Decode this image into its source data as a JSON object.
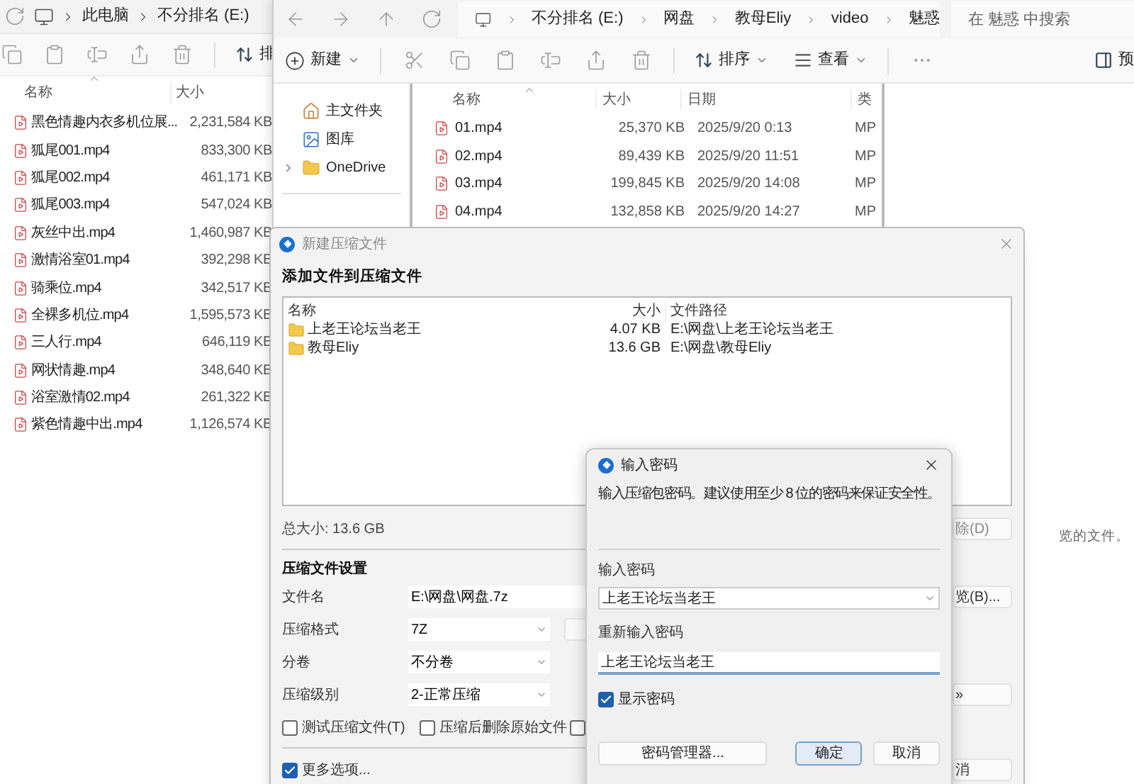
{
  "back_explorer": {
    "breadcrumb": [
      "此电脑",
      "不分排名 (E:)"
    ],
    "sort_partial": "排",
    "columns": [
      "名称",
      "大小"
    ],
    "files": [
      {
        "name": "黑色情趣内衣多机位展...",
        "size": "2,231,584 KB"
      },
      {
        "name": "狐尾001.mp4",
        "size": "833,300 KB"
      },
      {
        "name": "狐尾002.mp4",
        "size": "461,171 KB"
      },
      {
        "name": "狐尾003.mp4",
        "size": "547,024 KB"
      },
      {
        "name": "灰丝中出.mp4",
        "size": "1,460,987 KB"
      },
      {
        "name": "激情浴室01.mp4",
        "size": "392,298 KB"
      },
      {
        "name": "骑乘位.mp4",
        "size": "342,517 KB"
      },
      {
        "name": "全裸多机位.mp4",
        "size": "1,595,573 KB"
      },
      {
        "name": "三人行.mp4",
        "size": "646,119 KB"
      },
      {
        "name": "网状情趣.mp4",
        "size": "348,640 KB"
      },
      {
        "name": "浴室激情02.mp4",
        "size": "261,322 KB"
      },
      {
        "name": "紫色情趣中出.mp4",
        "size": "1,126,574 KB"
      }
    ]
  },
  "front_explorer": {
    "breadcrumb": [
      "不分排名 (E:)",
      "网盘",
      "教母Eliy",
      "video",
      "魅惑"
    ],
    "search": {
      "placeholder": "在 魅惑 中搜索"
    },
    "toolbar": {
      "new": "新建",
      "sort": "排序",
      "view": "查看",
      "preview_partial": "预"
    },
    "nav": [
      {
        "label": "主文件夹",
        "kind": "home",
        "expandable": false
      },
      {
        "label": "图库",
        "kind": "gallery",
        "expandable": false
      },
      {
        "label": "OneDrive",
        "kind": "cloud",
        "expandable": true
      }
    ],
    "columns": [
      "名称",
      "大小",
      "日期",
      "类"
    ],
    "files": [
      {
        "name": "01.mp4",
        "size": "25,370 KB",
        "date": "2025/9/20 0:13",
        "type": "MP"
      },
      {
        "name": "02.mp4",
        "size": "89,439 KB",
        "date": "2025/9/20 11:51",
        "type": "MP"
      },
      {
        "name": "03.mp4",
        "size": "199,845 KB",
        "date": "2025/9/20 14:08",
        "type": "MP"
      },
      {
        "name": "04.mp4",
        "size": "132,858 KB",
        "date": "2025/9/20 14:27",
        "type": "MP"
      }
    ],
    "preview_message": "览的文件。"
  },
  "compress_dialog": {
    "title": "新建压缩文件",
    "heading": "添加文件到压缩文件",
    "columns": [
      "名称",
      "大小",
      "文件路径"
    ],
    "items": [
      {
        "name": "上老王论坛当老王",
        "size": "4.07 KB",
        "path": "E:\\网盘\\上老王论坛当老王"
      },
      {
        "name": "教母Eliy",
        "size": "13.6 GB",
        "path": "E:\\网盘\\教母Eliy"
      }
    ],
    "total": "总大小: 13.6 GB",
    "remove_partial": "除(D)",
    "settings_heading": "压缩文件设置",
    "fields": [
      {
        "label": "文件名",
        "value": "E:\\网盘\\网盘.7z",
        "kind": "text"
      },
      {
        "label": "压缩格式",
        "value": "7Z",
        "kind": "select"
      },
      {
        "label": "分卷",
        "value": "不分卷",
        "kind": "select"
      },
      {
        "label": "压缩级别",
        "value": "2-正常压缩",
        "kind": "select"
      }
    ],
    "browse_partial": "览(B)...",
    "advanced_partial": "»",
    "options": [
      {
        "label": "测试压缩文件(T)",
        "checked": false
      },
      {
        "label": "压缩后删除原始文件",
        "checked": false
      },
      {
        "checked": false
      }
    ],
    "more_options": {
      "label": "更多选项...",
      "checked": true
    },
    "cancel_partial": "消"
  },
  "password_dialog": {
    "title": "输入密码",
    "hint": "输入压缩包密码。建议使用至少 8 位的密码来保证安全性。",
    "password_label": "输入密码",
    "password": "上老王论坛当老王",
    "confirm_label": "重新输入密码",
    "confirm": "上老王论坛当老王",
    "show_password": {
      "label": "显示密码",
      "checked": true
    },
    "buttons": [
      {
        "label": "密码管理器...",
        "default": false
      },
      {
        "label": "确定",
        "default": true
      },
      {
        "label": "取消",
        "default": false
      }
    ]
  }
}
